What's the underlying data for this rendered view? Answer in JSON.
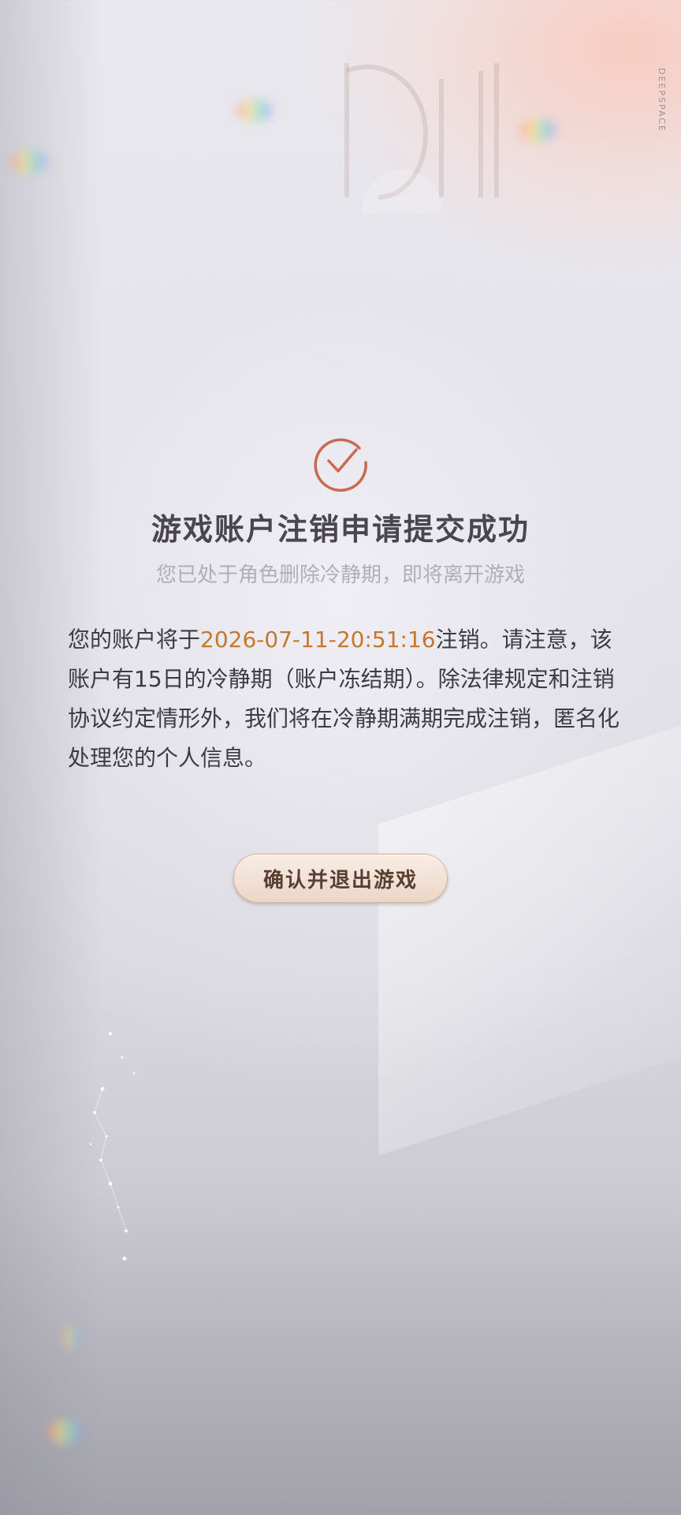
{
  "dialog": {
    "title": "游戏账户注销申请提交成功",
    "subtitle": "您已处于角色删除冷静期，即将离开游戏",
    "body_prefix": "您的账户将于",
    "date": "2026-07-11-20:51:16",
    "body_suffix": "注销。请注意，该账户有15日的冷静期（账户冻结期）。除法律规定和注销协议约定情形外，我们将在冷静期满期完成注销，匿名化处理您的个人信息。",
    "confirm_label": "确认并退出游戏"
  },
  "branding": {
    "corner_label": "DEEPSPACE"
  },
  "colors": {
    "accent": "#c8772e",
    "check_icon": "#c86a4f",
    "button_text": "#5b3e33"
  }
}
